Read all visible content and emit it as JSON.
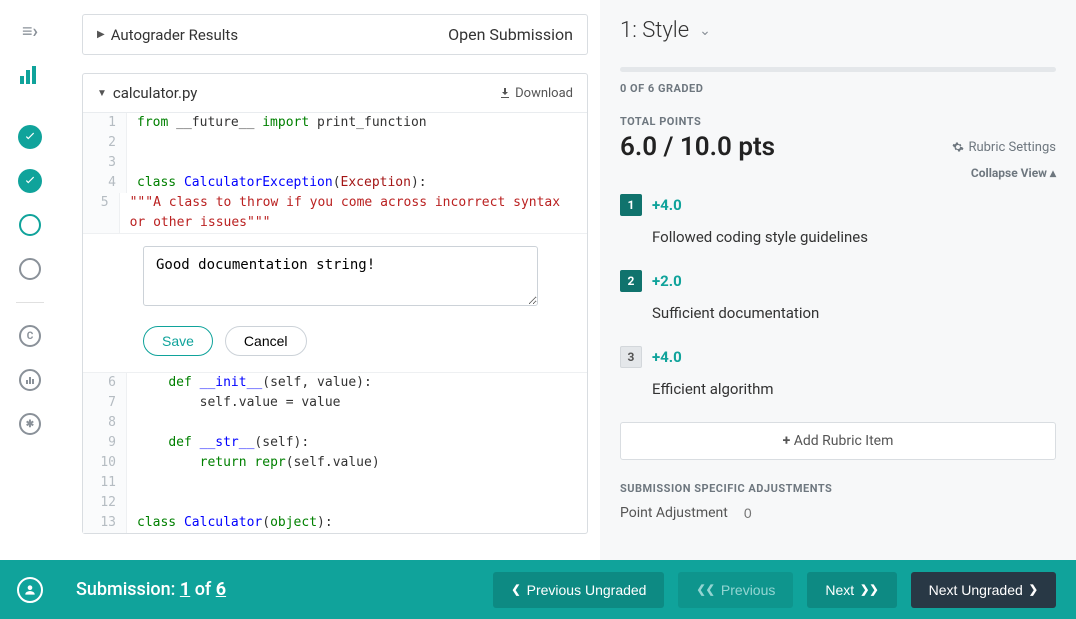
{
  "autograder_header": "Autograder Results",
  "open_submission": "Open Submission",
  "file_name": "calculator.py",
  "download_label": "Download",
  "code": {
    "1": {
      "raw": "from __future__ import print_function"
    },
    "2": {
      "raw": ""
    },
    "3": {
      "raw": ""
    },
    "4": {
      "raw": "class CalculatorException(Exception):"
    },
    "5": {
      "raw": "    \"\"\"A class to throw if you come across incorrect syntax or other issues\"\"\""
    },
    "6": {
      "raw": "    def __init__(self, value):"
    },
    "7": {
      "raw": "        self.value = value"
    },
    "8": {
      "raw": ""
    },
    "9": {
      "raw": "    def __str__(self):"
    },
    "10": {
      "raw": "        return repr(self.value)"
    },
    "11": {
      "raw": ""
    },
    "12": {
      "raw": ""
    },
    "13": {
      "raw": "class Calculator(object):"
    }
  },
  "comment_text": "Good documentation string!",
  "save_label": "Save",
  "cancel_label": "Cancel",
  "question_num": "1:",
  "question_title": "Style",
  "graded_text": "0 OF 6 GRADED",
  "total_points_label": "TOTAL POINTS",
  "total_points_value": "6.0 / 10.0 pts",
  "rubric_settings": "Rubric Settings",
  "collapse_view": "Collapse View ▴",
  "rubric": [
    {
      "num": "1",
      "pts": "+4.0",
      "desc": "Followed coding style guidelines",
      "on": true
    },
    {
      "num": "2",
      "pts": "+2.0",
      "desc": "Sufficient documentation",
      "on": true
    },
    {
      "num": "3",
      "pts": "+4.0",
      "desc": "Efficient algorithm",
      "on": false
    }
  ],
  "add_rubric": "Add Rubric Item",
  "ssa_label": "SUBMISSION SPECIFIC ADJUSTMENTS",
  "pa_label": "Point Adjustment",
  "pa_placeholder": "0",
  "submission_label": "Submission:",
  "submission_current": "1",
  "submission_of": "of",
  "submission_total": "6",
  "btn_prev_ungraded": "Previous Ungraded",
  "btn_previous": "Previous",
  "btn_next": "Next",
  "btn_next_ungraded": "Next Ungraded"
}
